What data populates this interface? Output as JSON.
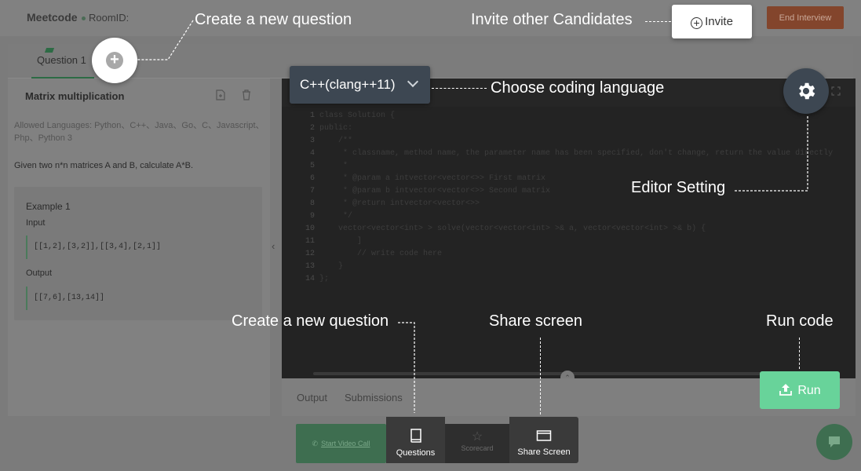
{
  "header": {
    "logo": "Meetcode",
    "room_label": "RoomID:",
    "end_button": "End Interview",
    "invite_button": "Invite"
  },
  "question_tabs": [
    {
      "label": "Question 1"
    }
  ],
  "question": {
    "title": "Matrix multiplication",
    "allowed_languages": "Allowed Languages: Python、C++、Java、Go、C、Javascript、Php、Python 3",
    "description": "Given two n*n matrices A and B, calculate A*B.",
    "example": {
      "title": "Example 1",
      "input_label": "Input",
      "input_value": "[[1,2],[3,2]],[[3,4],[2,1]]",
      "output_label": "Output",
      "output_value": "[[7,6],[13,14]]"
    }
  },
  "editor": {
    "language": "C++(clang++11)",
    "code_lines": [
      "class Solution {",
      "public:",
      "    /**",
      "     * classname, method name, the parameter name has been specified, don't change, return the value directly",
      "     *",
      "     * @param a intvector<vector<>> First matrix",
      "     * @param b intvector<vector<>> Second matrix",
      "     * @return intvector<vector<>>",
      "     */",
      "    vector<vector<int> > solve(vector<vector<int> >& a, vector<vector<int> >& b) {",
      "        ]",
      "        // write code here",
      "    }",
      "};"
    ]
  },
  "bottom_tabs": [
    "Output",
    "Submissions"
  ],
  "run_button": "Run",
  "toolbar": {
    "video_call": "Start Video Call",
    "questions": "Questions",
    "scorecard": "Scorecard",
    "share_screen": "Share Screen"
  },
  "callouts": {
    "new_question_top": "Create a new question",
    "invite": "Invite other Candidates",
    "coding_language": "Choose coding language",
    "editor_setting": "Editor Setting",
    "new_question_bottom": "Create a new question",
    "share_screen": "Share screen",
    "run_code": "Run code"
  },
  "colors": {
    "overlay_bg": "#7b7b7b",
    "brand_green": "#68d39a",
    "dark_button": "#3d4752",
    "end_interview": "#83452c"
  }
}
